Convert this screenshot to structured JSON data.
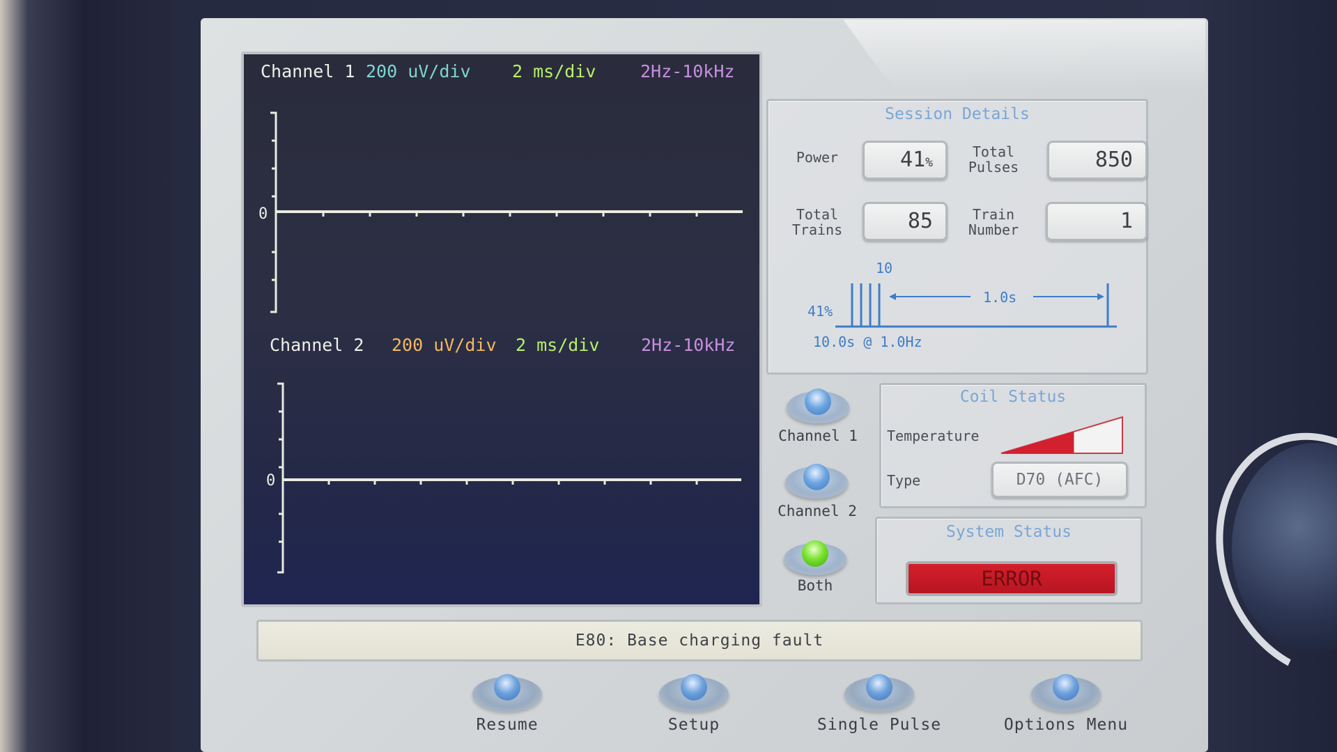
{
  "scope": {
    "channel1": {
      "name": "Channel 1",
      "volts": "200 uV/div",
      "time": "2 ms/div",
      "filter": "2Hz-10kHz",
      "zero": "0"
    },
    "channel2": {
      "name": "Channel 2",
      "volts": "200 uV/div",
      "time": "2 ms/div",
      "filter": "2Hz-10kHz",
      "zero": "0"
    }
  },
  "session": {
    "title": "Session Details",
    "power_label": "Power",
    "power_value": "41",
    "power_unit": "%",
    "total_pulses_label": "Total Pulses",
    "total_pulses_value": "850",
    "total_trains_label": "Total Trains",
    "total_trains_value": "85",
    "train_number_label": "Train Number",
    "train_number_value": "1",
    "diagram": {
      "pulse_count": "10",
      "intensity": "41%",
      "interval": "1.0s",
      "train_desc": "10.0s @ 1.0Hz"
    }
  },
  "channel_select": {
    "channel1": "Channel 1",
    "channel2": "Channel 2",
    "both": "Both",
    "active": "both"
  },
  "coil": {
    "title": "Coil Status",
    "temperature_label": "Temperature",
    "temperature_level": 0.6,
    "type_label": "Type",
    "type_value": "D70 (AFC)"
  },
  "system": {
    "title": "System Status",
    "status": "ERROR",
    "status_color": "#d41f2b"
  },
  "message": "E80: Base charging fault",
  "footer": {
    "resume": "Resume",
    "setup": "Setup",
    "single_pulse": "Single Pulse",
    "options_menu": "Options Menu"
  },
  "colors": {
    "accent_blue": "#3e7cc9",
    "active_green": "#78e22e",
    "error_red": "#d41f2b"
  }
}
